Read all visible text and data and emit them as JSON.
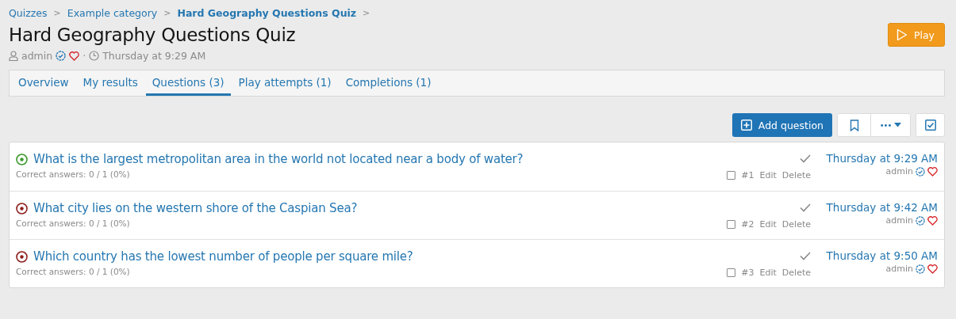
{
  "breadcrumb": [
    {
      "label": "Quizzes",
      "current": false
    },
    {
      "label": "Example category",
      "current": false
    },
    {
      "label": "Hard Geography Questions Quiz",
      "current": true
    }
  ],
  "breadcrumb_separator": ">",
  "title": "Hard Geography Questions Quiz",
  "meta": {
    "author": "admin",
    "separator": "·",
    "time": "Thursday at 9:29 AM"
  },
  "play_button": "Play",
  "tabs": [
    {
      "label": "Overview",
      "selected": false
    },
    {
      "label": "My results",
      "selected": false
    },
    {
      "label": "Questions (3)",
      "selected": true
    },
    {
      "label": "Play attempts (1)",
      "selected": false
    },
    {
      "label": "Completions (1)",
      "selected": false
    }
  ],
  "toolbar": {
    "add_button": "Add question",
    "more_button": "•••"
  },
  "questions": [
    {
      "title": "What is the largest metropolitan area in the world not located near a body of water?",
      "correct": true,
      "stats": "Correct answers: 0 / 1 (0%)",
      "number": "#1",
      "edit": "Edit",
      "delete": "Delete",
      "time": "Thursday at 9:29 AM",
      "author": "admin",
      "checked": false
    },
    {
      "title": "What city lies on the western shore of the Caspian Sea?",
      "correct": false,
      "stats": "Correct answers: 0 / 1 (0%)",
      "number": "#2",
      "edit": "Edit",
      "delete": "Delete",
      "time": "Thursday at 9:42 AM",
      "author": "admin",
      "checked": false
    },
    {
      "title": "Which country has the lowest number of people per square mile?",
      "correct": false,
      "stats": "Correct answers: 0 / 1 (0%)",
      "number": "#3",
      "edit": "Edit",
      "delete": "Delete",
      "time": "Thursday at 9:50 AM",
      "author": "admin",
      "checked": false
    }
  ]
}
